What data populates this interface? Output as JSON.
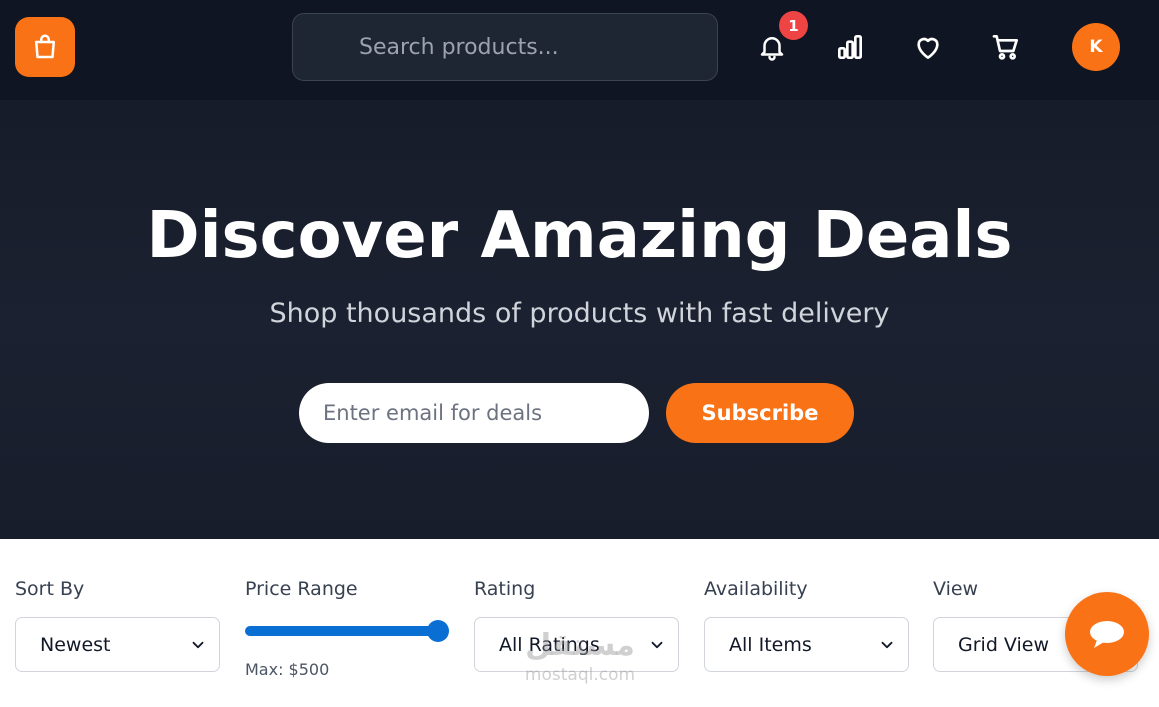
{
  "header": {
    "search_placeholder": "Search products...",
    "notification_count": "1",
    "avatar_initial": "K",
    "icons": [
      "shopping-bag-icon",
      "search-icon",
      "bell-icon",
      "bar-chart-icon",
      "heart-icon",
      "cart-icon"
    ]
  },
  "hero": {
    "title": "Discover Amazing Deals",
    "subtitle": "Shop thousands of products with fast delivery",
    "email_placeholder": "Enter email for deals",
    "subscribe_label": "Subscribe"
  },
  "filters": {
    "sort": {
      "label": "Sort By",
      "value": "Newest"
    },
    "price": {
      "label": "Price Range",
      "max_text": "Max: $500",
      "level_fraction": 1.0
    },
    "rating": {
      "label": "Rating",
      "value": "All Ratings"
    },
    "availability": {
      "label": "Availability",
      "value": "All Items"
    },
    "view": {
      "label": "View",
      "value": "Grid View"
    }
  },
  "watermark": {
    "brand_arabic": "مستقل",
    "brand_latin": "mostaql.com"
  },
  "colors": {
    "accent": "#f97316",
    "nav_bg": "#0f1522",
    "hero_bg": "#1b2130",
    "slider": "#0a6fd3",
    "badge": "#ef4444"
  }
}
